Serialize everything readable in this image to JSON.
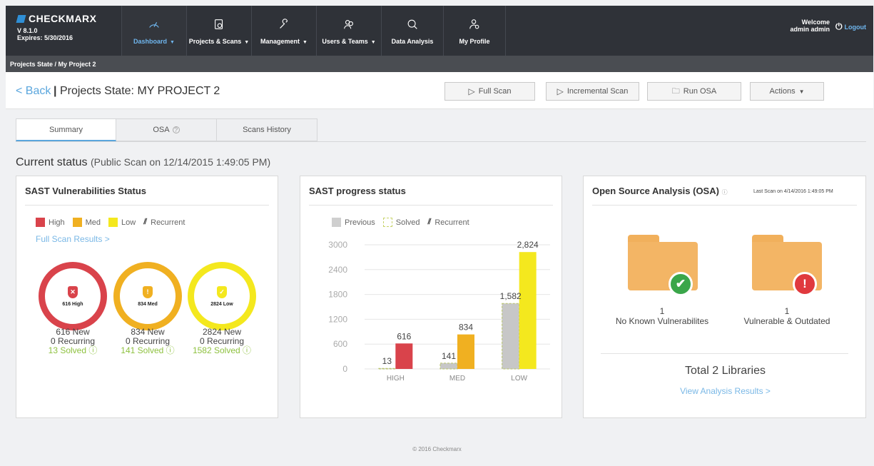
{
  "brand": {
    "name": "CHECKMARX",
    "version": "V 8.1.0",
    "expires": "Expires: 5/30/2016"
  },
  "nav": [
    {
      "label": "Dashboard",
      "icon": "gauge-icon",
      "caret": "▼",
      "active": true
    },
    {
      "label": "Projects & Scans",
      "icon": "projects-icon",
      "caret": "▼"
    },
    {
      "label": "Management",
      "icon": "wrench-icon",
      "caret": "▼"
    },
    {
      "label": "Users & Teams",
      "icon": "users-icon",
      "caret": "▼"
    },
    {
      "label": "Data Analysis",
      "icon": "analysis-icon",
      "caret": ""
    },
    {
      "label": "My Profile",
      "icon": "profile-icon",
      "caret": ""
    }
  ],
  "user": {
    "welcome": "Welcome",
    "name": "admin admin",
    "logout": "Logout"
  },
  "breadcrumb": "Projects State / My Project 2",
  "header": {
    "back": "< Back",
    "sep": "|",
    "title_prefix": "Projects State:",
    "title": "MY PROJECT 2",
    "buttons": {
      "full_scan": "Full Scan",
      "incremental_scan": "Incremental Scan",
      "run_osa": "Run OSA",
      "actions": "Actions"
    }
  },
  "tabs": [
    {
      "label": "Summary"
    },
    {
      "label": "OSA"
    },
    {
      "label": "Scans History"
    }
  ],
  "current_status": {
    "label": "Current status",
    "detail": "(Public Scan on 12/14/2015 1:49:05 PM)"
  },
  "sast_status": {
    "title": "SAST Vulnerabilities Status",
    "legend": {
      "high": "High",
      "med": "Med",
      "low": "Low",
      "recurrent": "Recurrent"
    },
    "link": "Full Scan Results >",
    "rings": [
      {
        "label": "616 High",
        "new": "616 New",
        "recurring": "0 Recurring",
        "solved": "13 Solved",
        "color": "#d9434b"
      },
      {
        "label": "834 Med",
        "new": "834 New",
        "recurring": "0 Recurring",
        "solved": "141 Solved",
        "color": "#f0b021"
      },
      {
        "label": "2824 Low",
        "new": "2824 New",
        "recurring": "0 Recurring",
        "solved": "1582 Solved",
        "color": "#f4e81e"
      }
    ]
  },
  "sast_progress": {
    "title": "SAST progress status",
    "legend": {
      "previous": "Previous",
      "solved": "Solved",
      "recurrent": "Recurrent"
    }
  },
  "chart_data": {
    "type": "bar",
    "categories": [
      "HIGH",
      "MED",
      "LOW"
    ],
    "series": [
      {
        "name": "Solved",
        "values": [
          13,
          141,
          1582
        ],
        "color": "#c7c7c7"
      },
      {
        "name": "",
        "values": [
          616,
          834,
          2824
        ],
        "colors": [
          "#d9434b",
          "#f0b021",
          "#f4e81e"
        ]
      }
    ],
    "ylim": [
      0,
      3000
    ],
    "yticks": [
      0,
      600,
      1200,
      1800,
      2400,
      3000
    ],
    "data_labels": [
      [
        "13",
        "616"
      ],
      [
        "141",
        "834"
      ],
      [
        "1,582",
        "2,824"
      ]
    ]
  },
  "osa": {
    "title": "Open Source Analysis (OSA)",
    "last_scan": "Last Scan on 4/14/2016 1:49:05 PM",
    "items": [
      {
        "count": "1",
        "label": "No Known Vulnerabilites",
        "badge": "✔",
        "color": "#3aa64a"
      },
      {
        "count": "1",
        "label": "Vulnerable & Outdated",
        "badge": "!",
        "color": "#e0393e"
      }
    ],
    "total": "Total 2 Libraries",
    "link": "View Analysis Results >"
  },
  "footer": "© 2016 Checkmarx"
}
